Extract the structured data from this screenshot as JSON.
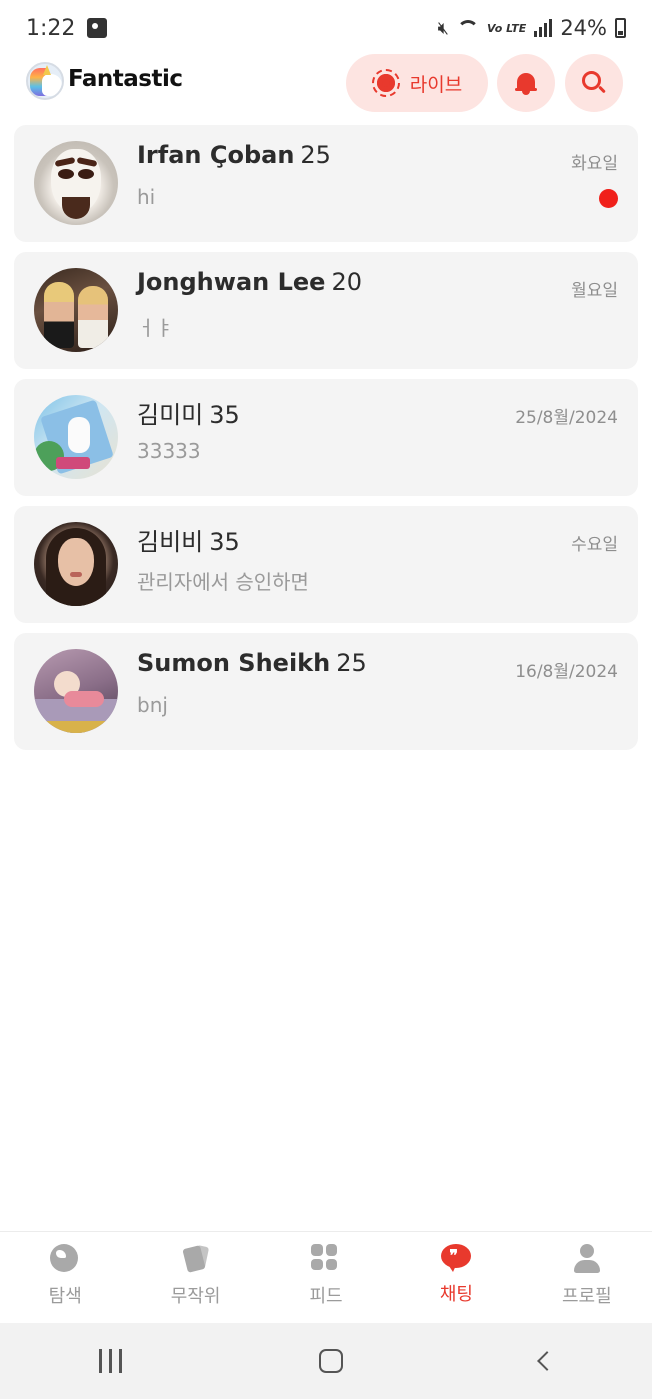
{
  "status_bar": {
    "time": "1:22",
    "network_label": "Vo LTE",
    "battery": "24%"
  },
  "header": {
    "brand": "Fantastic",
    "live_label": "라이브",
    "accent_color": "#e8392d"
  },
  "chats": [
    {
      "name": "Irfan Çoban",
      "age": "25",
      "preview": "hi",
      "date": "화요일",
      "unread": true
    },
    {
      "name": "Jonghwan Lee",
      "age": "20",
      "preview": "ㅓㅑ",
      "date": "월요일",
      "unread": false
    },
    {
      "name": "김미미",
      "age": "35",
      "preview": "33333",
      "date": "25/8월/2024",
      "unread": false
    },
    {
      "name": "김비비",
      "age": "35",
      "preview": "관리자에서 승인하면",
      "date": "수요일",
      "unread": false
    },
    {
      "name": "Sumon Sheikh",
      "age": "25",
      "preview": "bnj",
      "date": "16/8월/2024",
      "unread": false
    }
  ],
  "bottom_nav": {
    "items": [
      {
        "label": "탐색",
        "icon": "globe-icon"
      },
      {
        "label": "무작위",
        "icon": "cards-icon"
      },
      {
        "label": "피드",
        "icon": "grid-icon"
      },
      {
        "label": "채팅",
        "icon": "chat-bubble-icon"
      },
      {
        "label": "프로필",
        "icon": "person-icon"
      }
    ],
    "active_index": 3
  }
}
